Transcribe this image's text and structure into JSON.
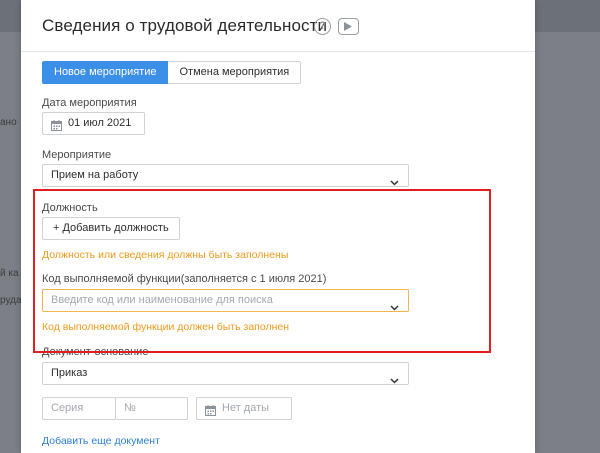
{
  "background": {
    "fragments": [
      "ано",
      "й ка",
      "руда"
    ]
  },
  "modal": {
    "title": "Сведения о трудовой деятельности",
    "help_icon": "?",
    "tabs": [
      {
        "label": "Новое мероприятие",
        "active": true
      },
      {
        "label": "Отмена мероприятия",
        "active": false
      }
    ],
    "event_date": {
      "label": "Дата мероприятия",
      "value": "01 июл 2021"
    },
    "event": {
      "label": "Мероприятие",
      "value": "Прием на работу"
    },
    "position": {
      "label": "Должность",
      "add_button": "+ Добавить должность",
      "error": "Должность или сведения должны быть заполнены"
    },
    "function_code": {
      "label": "Код выполняемой функции(заполняется с 1 июля 2021)",
      "placeholder": "Введите код или наименование для поиска",
      "error": "Код выполняемой функции должен быть заполнен"
    },
    "document": {
      "label": "Документ-основание",
      "value": "Приказ",
      "series_placeholder": "Серия",
      "number_placeholder": "№",
      "date_placeholder": "Нет даты",
      "add_link": "Добавить еще документ"
    }
  },
  "colors": {
    "accent": "#3b8fe6",
    "warning": "#ef9a1c",
    "highlight": "#e02020",
    "link": "#2e7fd6"
  }
}
